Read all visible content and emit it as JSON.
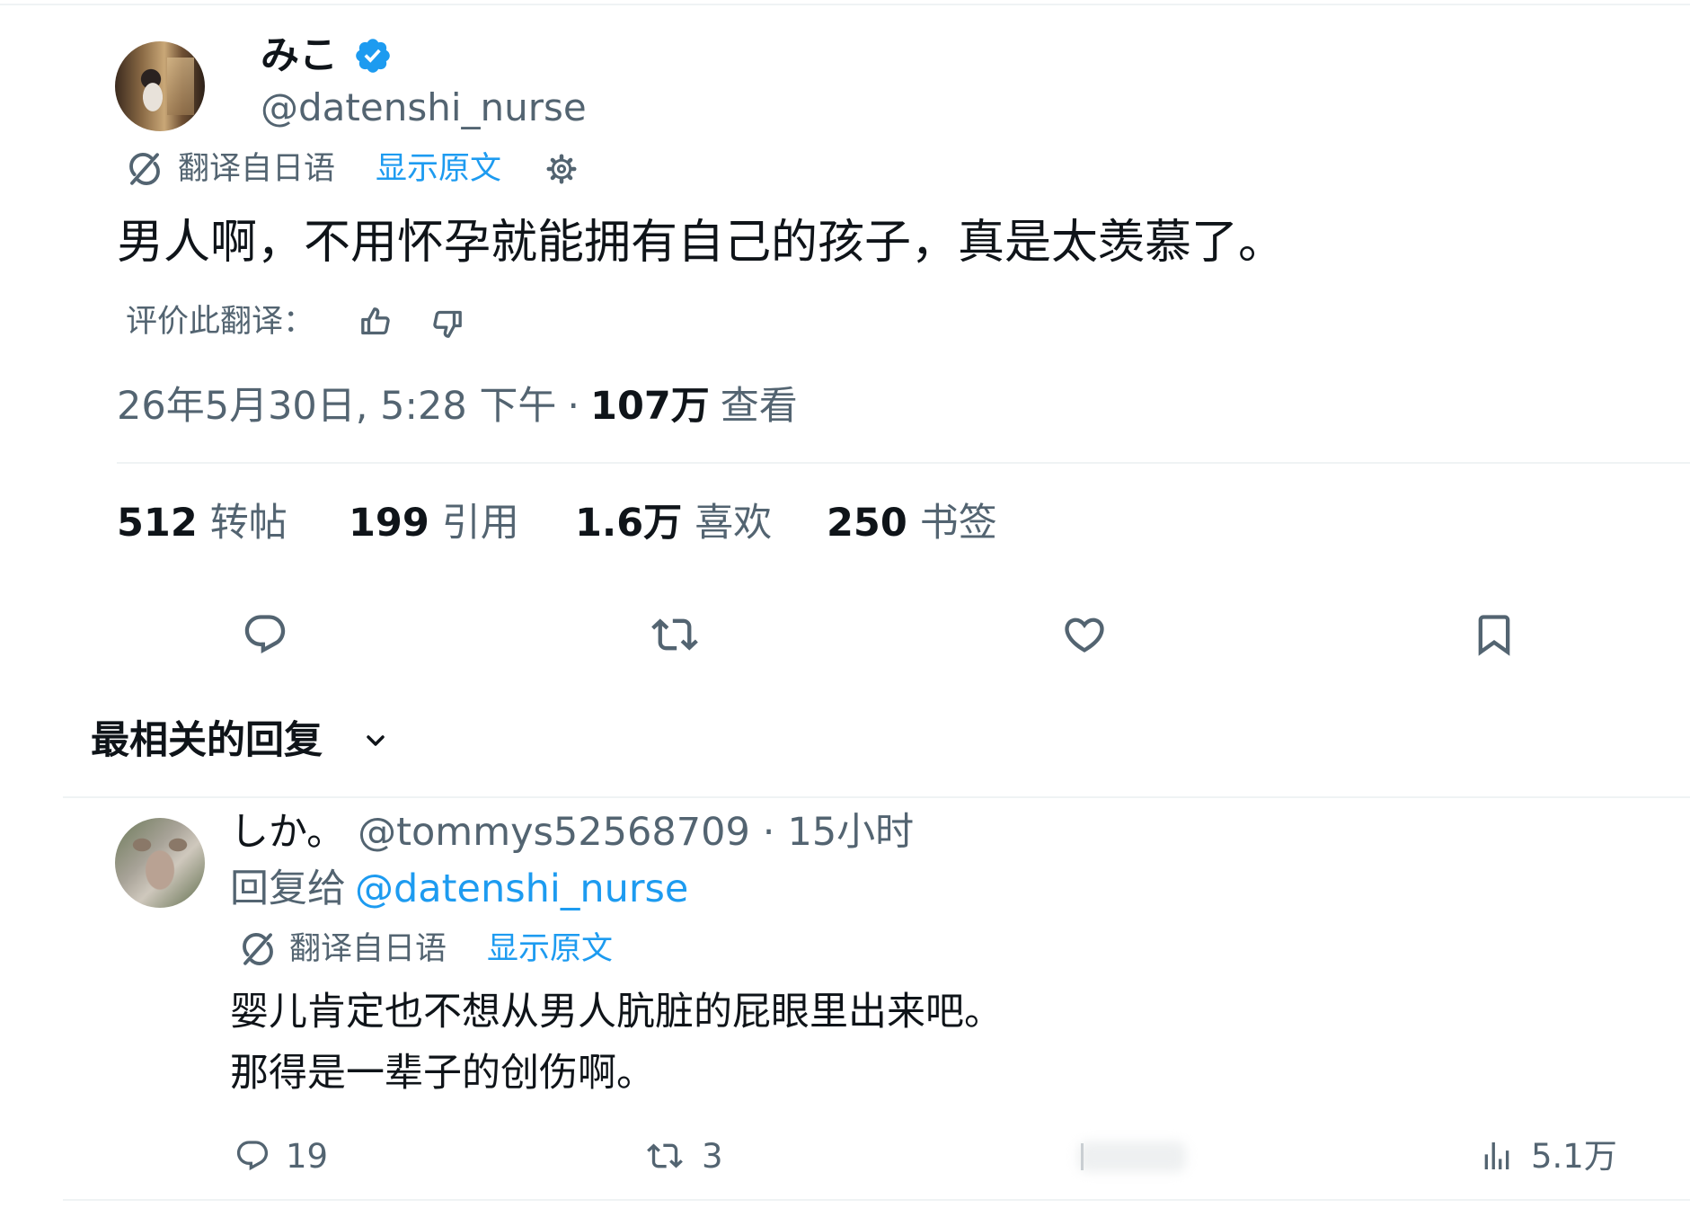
{
  "colors": {
    "text": "#0f1419",
    "secondary": "#536471",
    "link": "#1d9bf0",
    "divider": "#eff3f4",
    "verified": "#1d9bf0"
  },
  "tweet": {
    "author": {
      "display_name": "みこ",
      "handle": "@datenshi_nurse",
      "verified": true,
      "avatar_icon": "avatar-photo",
      "badge_icon": "verified-badge-icon"
    },
    "translation": {
      "icon": "translate-icon",
      "label": "翻译自日语",
      "show_original": "显示原文",
      "settings_icon": "gear-icon"
    },
    "text": "男人啊，不用怀孕就能拥有自己的孩子，真是太羡慕了。",
    "rate_translation": {
      "label": "评价此翻译：",
      "icons": [
        "thumbs-up-icon",
        "thumbs-down-icon"
      ]
    },
    "meta": {
      "timestamp": "26年5月30日, 5:28 下午",
      "separator": "·",
      "views_count": "107万",
      "views_label": "查看"
    },
    "stats": [
      {
        "count": "512",
        "label": "转帖"
      },
      {
        "count": "199",
        "label": "引用"
      },
      {
        "count": "1.6万",
        "label": "喜欢"
      },
      {
        "count": "250",
        "label": "书签"
      }
    ],
    "actions": [
      "reply-icon",
      "retweet-icon",
      "like-icon",
      "bookmark-icon"
    ]
  },
  "replies_sort": {
    "label": "最相关的回复",
    "icon": "chevron-down-icon"
  },
  "reply": {
    "author": {
      "display_name": "しか。",
      "handle": "@tommys52568709",
      "avatar_icon": "avatar-photo"
    },
    "separator": "·",
    "time": "15小时",
    "reply_to": {
      "label": "回复给",
      "handle": "@datenshi_nurse"
    },
    "translation": {
      "icon": "translate-icon",
      "label": "翻译自日语",
      "show_original": "显示原文"
    },
    "text_lines": [
      "婴儿肯定也不想从男人肮脏的屁眼里出来吧。",
      "那得是一辈子的创伤啊。"
    ],
    "actions": {
      "reply_count": "19",
      "retweet_count": "3",
      "views_count": "5.1万",
      "icons": [
        "reply-icon",
        "retweet-icon",
        "views-icon"
      ]
    }
  }
}
